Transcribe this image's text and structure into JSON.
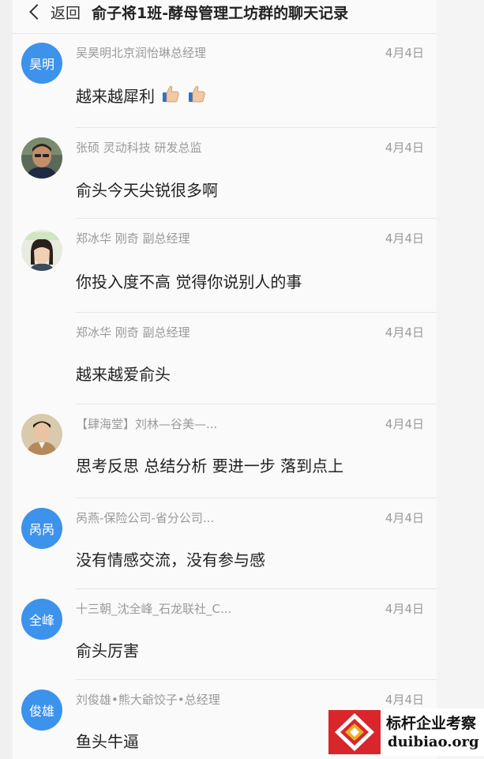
{
  "header": {
    "back_label": "返回",
    "title": "俞子将1班-酵母管理工坊群的聊天记录"
  },
  "messages": [
    {
      "avatar_text": "昊明",
      "sender": "吴昊明北京润怡琳总经理",
      "date": "4月4日",
      "text": "越来越犀利"
    },
    {
      "avatar_text": "",
      "sender": "张硕 灵动科技 研发总监",
      "date": "4月4日",
      "text": "俞头今天尖锐很多啊"
    },
    {
      "avatar_text": "",
      "sender": "郑冰华 刚奇 副总经理",
      "date": "4月4日",
      "text": "你投入度不高 觉得你说别人的事"
    },
    {
      "avatar_text": "",
      "sender": "郑冰华 刚奇 副总经理",
      "date": "4月4日",
      "text": "越来越爱俞头"
    },
    {
      "avatar_text": "",
      "sender": "【肆海堂】刘林—谷美—...",
      "date": "4月4日",
      "text": "思考反思 总结分析 要进一步 落到点上"
    },
    {
      "avatar_text": "呙呙",
      "sender": "呙燕-保险公司-省分公司...",
      "date": "4月4日",
      "text": "没有情感交流，没有参与感"
    },
    {
      "avatar_text": "全峰",
      "sender": "十三朝_沈全峰_石龙联社_C...",
      "date": "4月4日",
      "text": "俞头厉害"
    },
    {
      "avatar_text": "俊雄",
      "sender": "刘俊雄•熊大爺饺子•总经理",
      "date": "4月4日",
      "text": "鱼头牛逼"
    }
  ],
  "watermark": {
    "name": "标杆企业考察",
    "domain": "duibiao.org"
  },
  "colors": {
    "avatar_blue": "#3d92ec",
    "meta_gray": "#9a9a9a",
    "logo_red": "#d9262c"
  }
}
